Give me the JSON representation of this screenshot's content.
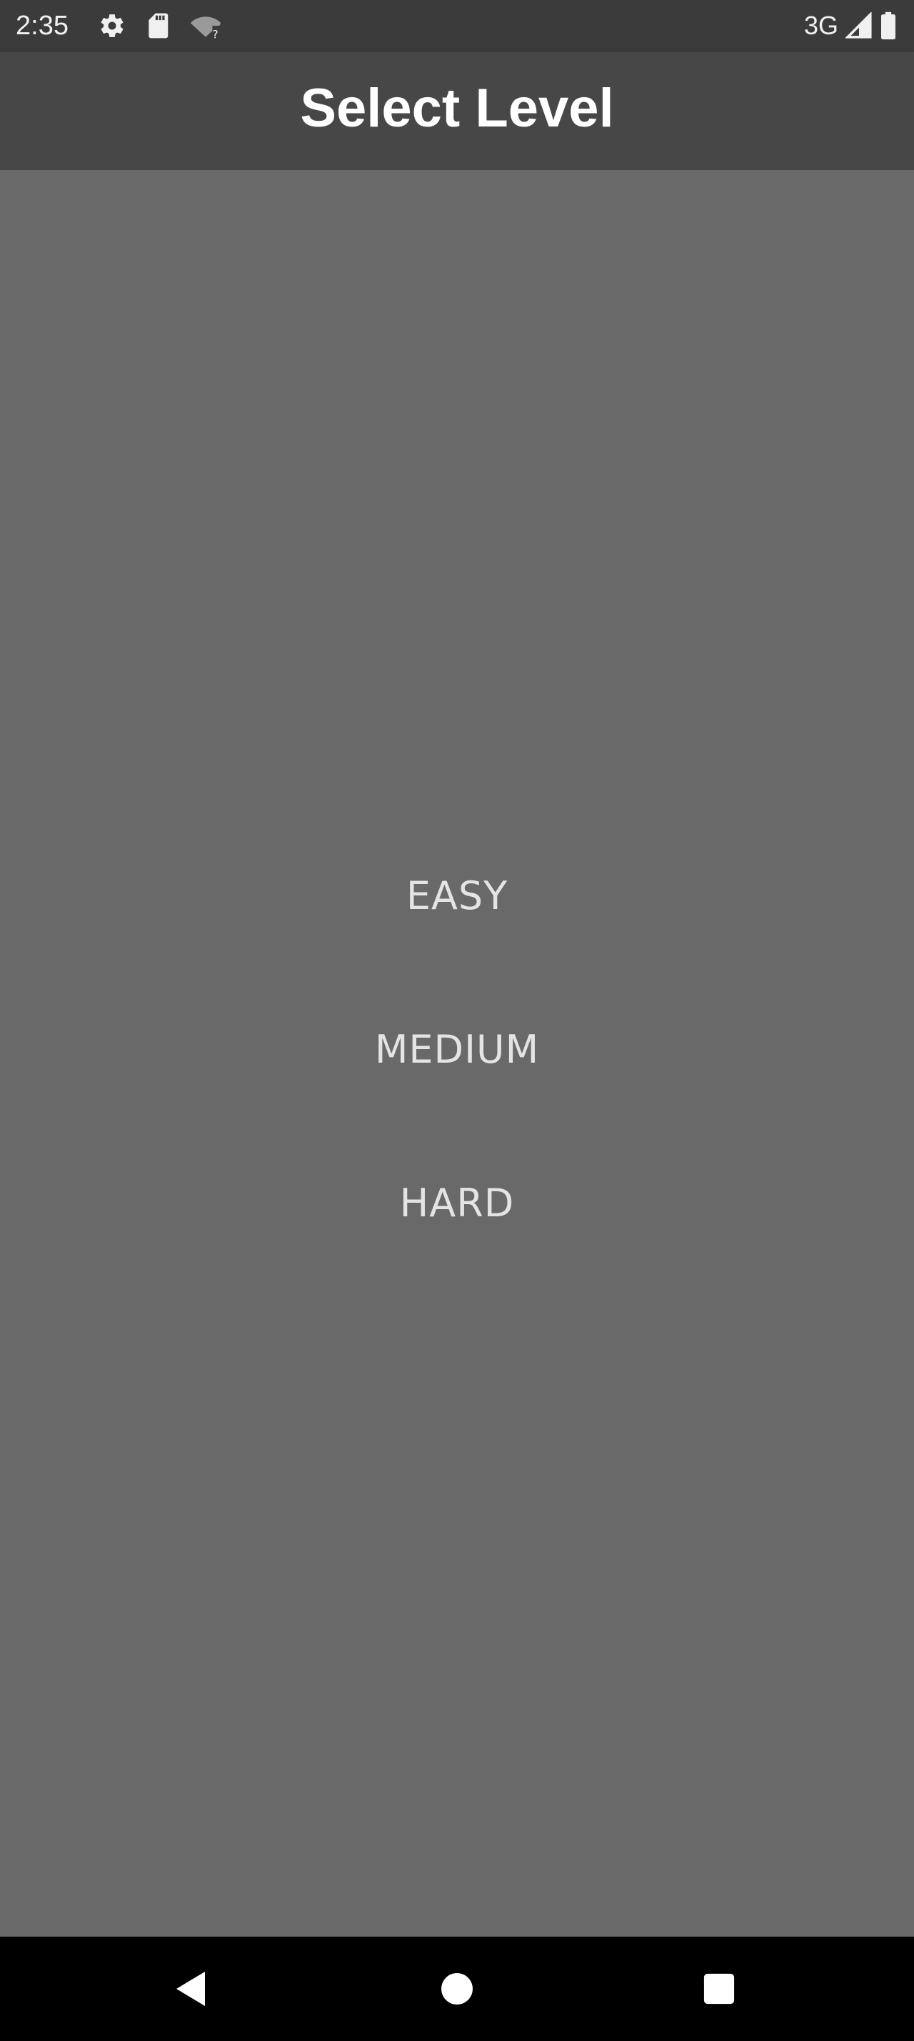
{
  "status_bar": {
    "time": "2:35",
    "network_type": "3G",
    "icons": [
      "settings-icon",
      "sd-card-icon",
      "wifi-unknown-icon",
      "cell-signal-icon",
      "battery-icon"
    ]
  },
  "app_bar": {
    "title": "Select Level"
  },
  "levels": [
    {
      "label": "EASY"
    },
    {
      "label": "MEDIUM"
    },
    {
      "label": "HARD"
    }
  ],
  "nav_bar": {
    "icons": [
      "back-icon",
      "home-icon",
      "recents-icon"
    ]
  },
  "colors": {
    "background": "#696969",
    "app_bar": "#474747",
    "status_bar": "#3b3b3b",
    "level_text": "#e4e4e4",
    "title_text": "#ffffff",
    "nav_bar": "#000000"
  }
}
